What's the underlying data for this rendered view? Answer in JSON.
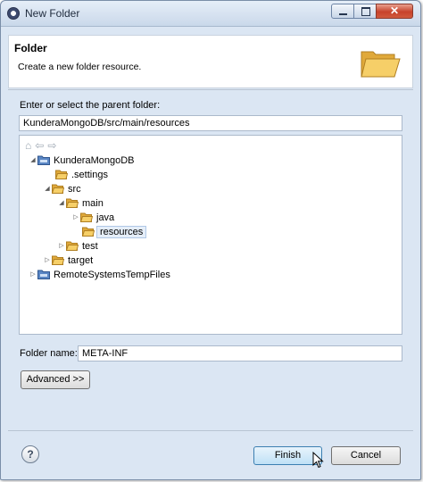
{
  "window": {
    "title": "New Folder"
  },
  "header": {
    "title": "Folder",
    "description": "Create a new folder resource."
  },
  "parent": {
    "label": "Enter or select the parent folder:",
    "value": "KunderaMongoDB/src/main/resources"
  },
  "tree": {
    "nav_icons": [
      "home-icon",
      "back-icon",
      "forward-icon"
    ],
    "items": [
      {
        "label": "KunderaMongoDB",
        "toggle": "◢",
        "icon": "project-folder-icon"
      },
      {
        "label": ".settings",
        "toggle": "",
        "icon": "folder-icon"
      },
      {
        "label": "src",
        "toggle": "◢",
        "icon": "folder-icon"
      },
      {
        "label": "main",
        "toggle": "◢",
        "icon": "folder-icon"
      },
      {
        "label": "java",
        "toggle": "▷",
        "icon": "folder-icon"
      },
      {
        "label": "resources",
        "toggle": "",
        "icon": "folder-icon",
        "selected": true
      },
      {
        "label": "test",
        "toggle": "▷",
        "icon": "folder-icon"
      },
      {
        "label": "target",
        "toggle": "▷",
        "icon": "folder-icon"
      },
      {
        "label": "RemoteSystemsTempFiles",
        "toggle": "▷",
        "icon": "project-folder-icon"
      }
    ]
  },
  "folder_name": {
    "label": "Folder name:",
    "value": "META-INF"
  },
  "buttons": {
    "advanced": "Advanced >>",
    "finish": "Finish",
    "cancel": "Cancel",
    "help": "?"
  },
  "colors": {
    "folder": "#f3c44e",
    "project": "#5a86c4",
    "selection": "#e5eef9"
  }
}
